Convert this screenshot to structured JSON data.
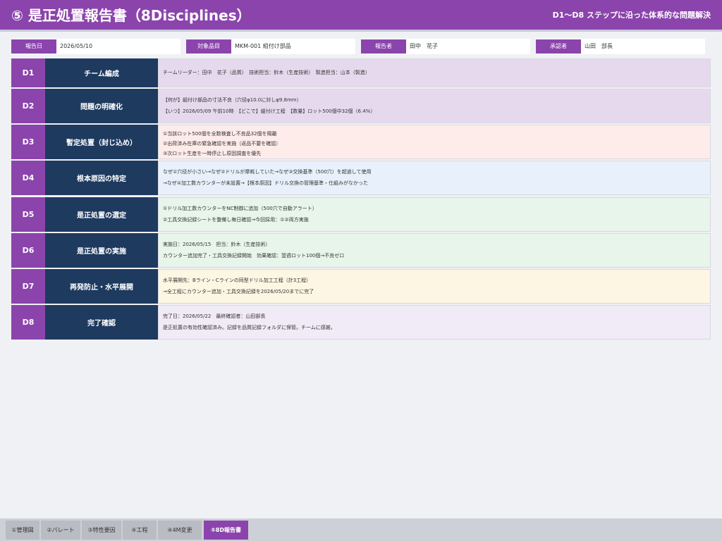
{
  "header": {
    "title": "⑤ 是正処置報告書（8Disciplines）",
    "subtitle": "D1～D8 ステップに沿った体系的な問題解決"
  },
  "meta": [
    {
      "label": "報告日",
      "value": "2026/05/10"
    },
    {
      "label": "対象品目",
      "value": "MKM-001 組付け部品"
    },
    {
      "label": "報告者",
      "value": "田中　花子"
    },
    {
      "label": "承認者",
      "value": "山田　部長"
    }
  ],
  "steps": [
    {
      "code": "D1",
      "title": "チーム編成",
      "bg": "#e6d9ee",
      "lines": [
        "チームリーダー：田中　花子（品質）　技術担当：鈴木（生産技術）　製造担当：山本（製造）"
      ]
    },
    {
      "code": "D2",
      "title": "問題の明確化",
      "bg": "#e6d9ee",
      "lines": [
        "【何が】組付け部品の寸法不良（穴径φ10.0に対しφ9.8mm）",
        "【いつ】2026/05/09 午前10時　【どこで】組付け工程　【数量】ロット500個中32個（6.4%）"
      ]
    },
    {
      "code": "D3",
      "title": "暫定処置（封じ込め）",
      "bg": "#fdecea",
      "lines": [
        "①当該ロット500個を全数検査し不良品32個を隔離",
        "②出荷済み在庫の緊急確認を実施（返品不要を確認）",
        "③次ロット生産を一時停止し原因調査を優先"
      ]
    },
    {
      "code": "D4",
      "title": "根本原因の特定",
      "bg": "#e8f1fb",
      "lines": [
        "なぜ①穴径が小さい→なぜ②ドリルが摩耗していた→なぜ③交換基準（500穴）を超過して使用",
        "→なぜ④加工数カウンターが未設置→【根本原因】ドリル交換の管理基準・仕組みがなかった"
      ]
    },
    {
      "code": "D5",
      "title": "是正処置の選定",
      "bg": "#e8f5ea",
      "lines": [
        "①ドリル加工数カウンターをNC制御に追加（500穴で自動アラート）",
        "②工具交換記録シートを整備し毎日確認→今回採用：①②両方実施"
      ]
    },
    {
      "code": "D6",
      "title": "是正処置の実施",
      "bg": "#e8f5ea",
      "lines": [
        "実施日：2026/05/15　担当：鈴木（生産技術）",
        "カウンター追加完了・工具交換記録開始　効果確認：翌週ロット100個→不良ゼロ"
      ]
    },
    {
      "code": "D7",
      "title": "再発防止・水平展開",
      "bg": "#fdf6e3",
      "lines": [
        "水平展開先：Bライン・Cラインの同型ドリル加工工程（計3工程）",
        "→全工程にカウンター追加・工具交換記録を2026/05/20までに完了"
      ]
    },
    {
      "code": "D8",
      "title": "完了確認",
      "bg": "#f1eaf7",
      "lines": [
        "完了日：2026/05/22　最終確認者：山田部長",
        "是正処置の有効性確認済み。記録を品質記録フォルダに保管。チームに感謝。"
      ]
    }
  ],
  "tabs": [
    {
      "label": "①管理図",
      "active": false
    },
    {
      "label": "②パレート",
      "active": false
    },
    {
      "label": "③特性要因",
      "active": false
    },
    {
      "label": "④工程",
      "active": false
    },
    {
      "label": "④4M変更",
      "active": false
    },
    {
      "label": "⑤8D報告書",
      "active": true
    }
  ]
}
